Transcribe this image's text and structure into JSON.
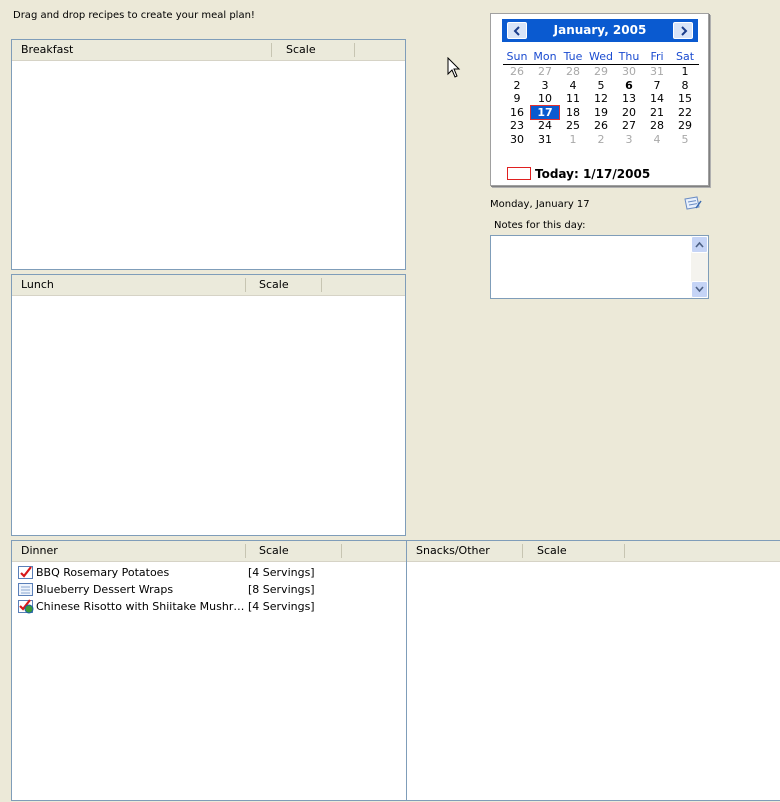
{
  "instructions": "Drag and drop recipes to create your meal plan!",
  "breakfast": {
    "col_name": "Breakfast",
    "col_scale": "Scale"
  },
  "lunch": {
    "col_name": "Lunch",
    "col_scale": "Scale"
  },
  "dinner": {
    "col_name": "Dinner",
    "col_scale": "Scale",
    "items": [
      {
        "name": "BBQ Rosemary Potatoes",
        "scale": "[4 Servings]",
        "icon": "checked-recipe-icon"
      },
      {
        "name": "Blueberry Dessert Wraps",
        "scale": "[8 Servings]",
        "icon": "recipe-card-icon"
      },
      {
        "name": "Chinese Risotto with Shiitake Mushr…",
        "scale": "[4 Servings]",
        "icon": "checked-globe-recipe-icon"
      }
    ]
  },
  "snacks": {
    "col_name": "Snacks/Other",
    "col_scale": "Scale"
  },
  "calendar": {
    "month_title": "January, 2005",
    "dow": [
      "Sun",
      "Mon",
      "Tue",
      "Wed",
      "Thu",
      "Fri",
      "Sat"
    ],
    "weeks": [
      [
        "26",
        "27",
        "28",
        "29",
        "30",
        "31",
        "1"
      ],
      [
        "2",
        "3",
        "4",
        "5",
        "6",
        "7",
        "8"
      ],
      [
        "9",
        "10",
        "11",
        "12",
        "13",
        "14",
        "15"
      ],
      [
        "16",
        "17",
        "18",
        "19",
        "20",
        "21",
        "22"
      ],
      [
        "23",
        "24",
        "25",
        "26",
        "27",
        "28",
        "29"
      ],
      [
        "30",
        "31",
        "1",
        "2",
        "3",
        "4",
        "5"
      ]
    ],
    "today_label": "Today: 1/17/2005"
  },
  "selected_date_label": "Monday, January 17",
  "notes_label": "Notes for this day:",
  "notes_value": ""
}
